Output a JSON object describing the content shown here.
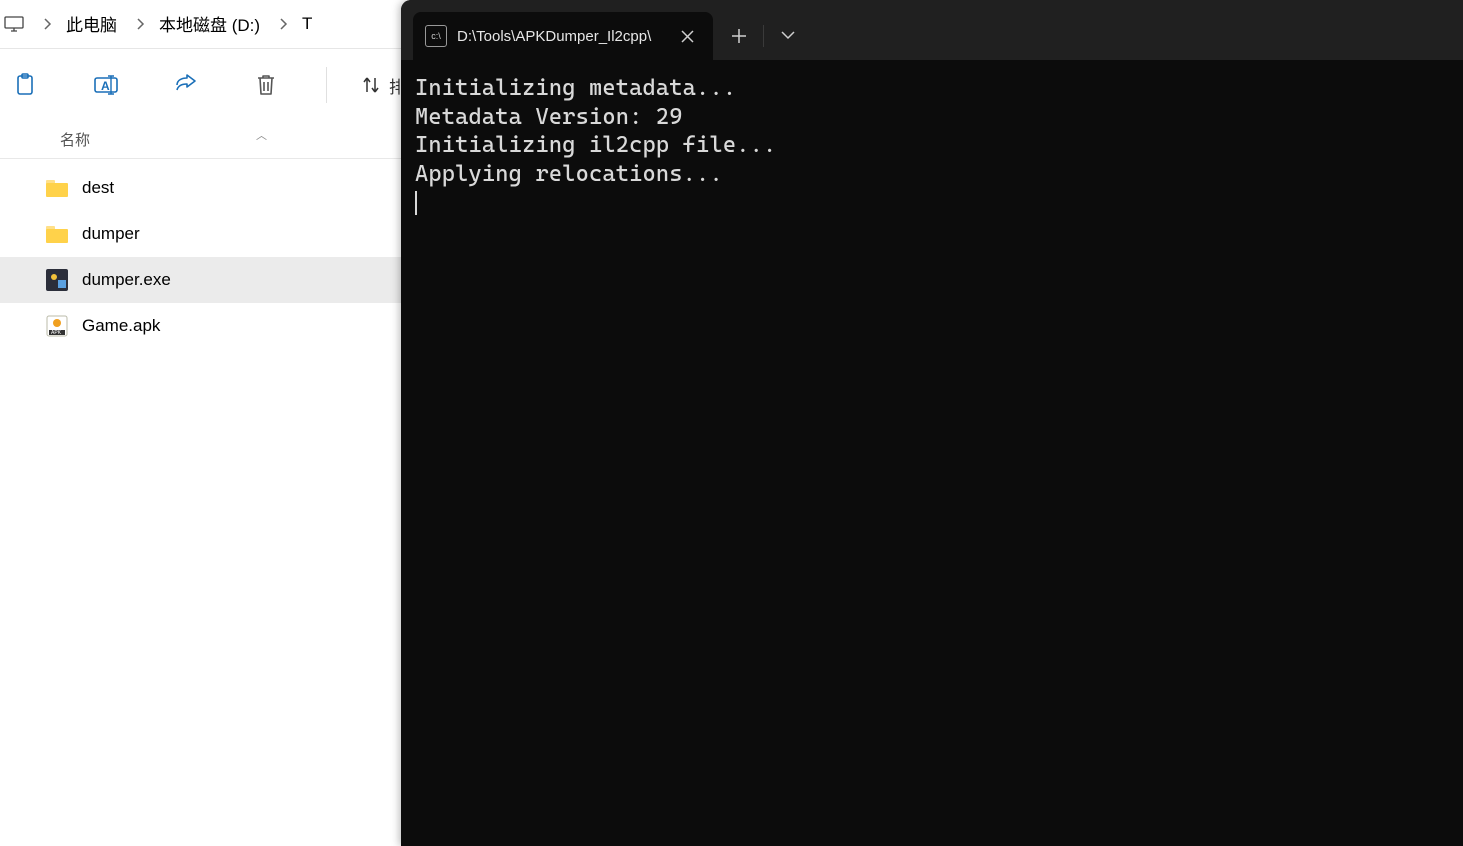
{
  "explorer": {
    "breadcrumb": [
      {
        "icon": "monitor-icon",
        "text": ""
      },
      {
        "text": "此电脑"
      },
      {
        "text": "本地磁盘 (D:)"
      },
      {
        "text": "T"
      }
    ],
    "toolbar": {
      "sort_label": "排序"
    },
    "header": {
      "name_col": "名称"
    },
    "files": [
      {
        "name": "dest",
        "type": "folder"
      },
      {
        "name": "dumper",
        "type": "folder"
      },
      {
        "name": "dumper.exe",
        "type": "exe",
        "selected": true
      },
      {
        "name": "Game.apk",
        "type": "apk"
      }
    ]
  },
  "terminal": {
    "tab_title": "D:\\Tools\\APKDumper_Il2cpp\\",
    "output_lines": [
      "Initializing metadata...",
      "Metadata Version: 29",
      "Initializing il2cpp file...",
      "Applying relocations..."
    ]
  }
}
